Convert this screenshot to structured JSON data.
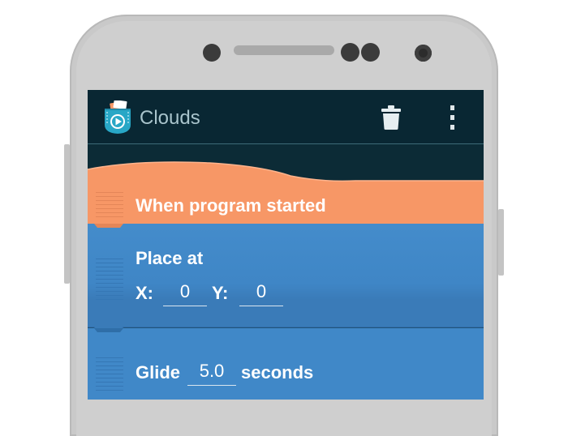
{
  "app": {
    "title": "Clouds",
    "icons": {
      "logo": "pocket-code-logo",
      "delete": "trash-icon",
      "menu": "overflow-menu-icon"
    }
  },
  "colors": {
    "toolbar_bg": "#092733",
    "event_block": "#f79766",
    "motion_block": "#4088c8"
  },
  "blocks": {
    "start": {
      "label": "When program started"
    },
    "place_at": {
      "label": "Place at",
      "x_label": "X:",
      "x_value": "0",
      "y_label": "Y:",
      "y_value": "0"
    },
    "glide": {
      "label": "Glide",
      "seconds_value": "5.0",
      "seconds_label": "seconds"
    }
  }
}
